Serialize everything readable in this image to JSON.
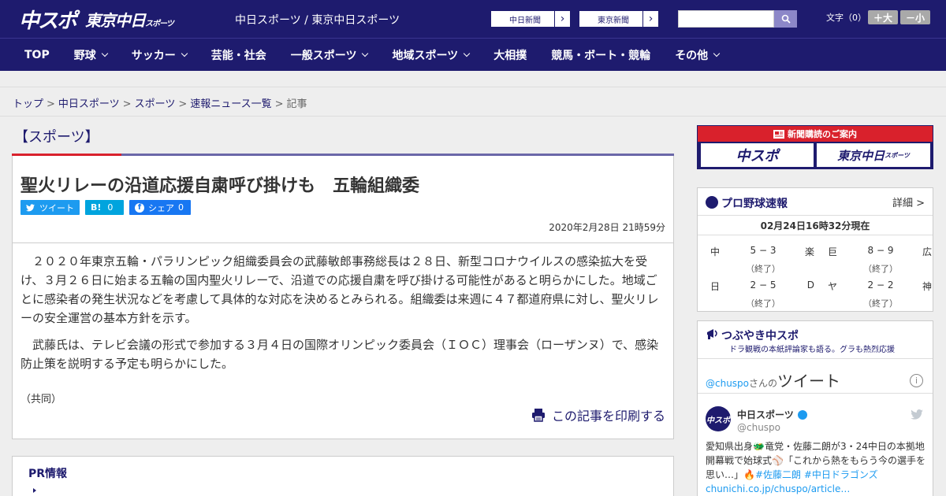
{
  "header": {
    "logo_main": "中スポ",
    "logo_sub": "東京中日",
    "logo_sub_small": "スポーツ",
    "site_link_1": "中日スポーツ",
    "site_link_sep": " / ",
    "site_link_2": "東京中日スポーツ",
    "btn_chunichi": "中日新聞",
    "btn_tokyo": "東京新聞",
    "search_placeholder": "",
    "font_size_label": "文字（0）",
    "font_plus": "＋大",
    "font_minus": "－小"
  },
  "nav": {
    "items": [
      {
        "label": "TOP",
        "dropdown": false
      },
      {
        "label": "野球",
        "dropdown": true
      },
      {
        "label": "サッカー",
        "dropdown": true
      },
      {
        "label": "芸能・社会",
        "dropdown": false
      },
      {
        "label": "一般スポーツ",
        "dropdown": true
      },
      {
        "label": "地域スポーツ",
        "dropdown": true
      },
      {
        "label": "大相撲",
        "dropdown": false
      },
      {
        "label": "競馬・ボート・競輪",
        "dropdown": false
      },
      {
        "label": "その他",
        "dropdown": true
      }
    ]
  },
  "breadcrumb": {
    "items": [
      "トップ",
      "中日スポーツ",
      "スポーツ",
      "速報ニュース一覧"
    ],
    "sep": ">",
    "current": "記事"
  },
  "article": {
    "section": "【スポーツ】",
    "headline": "聖火リレーの沿道応援自粛呼び掛けも　五輪組織委",
    "share_tweet": "ツイート",
    "share_hatena": "B!",
    "share_hatena_count": "0",
    "share_fb": "シェア",
    "share_fb_count": "0",
    "date": "2020年2月28日 21時59分",
    "paragraphs": [
      "２０２０年東京五輪・パラリンピック組織委員会の武藤敏郎事務総長は２８日、新型コロナウイルスの感染拡大を受け、３月２６日に始まる五輪の国内聖火リレーで、沿道での応援自粛を呼び掛ける可能性があると明らかにした。地域ごとに感染者の発生状況などを考慮して具体的な対応を決めるとみられる。組織委は来週に４７都道府県に対し、聖火リレーの安全運営の基本方針を示す。",
      "武藤氏は、テレビ会議の形式で参加する３月４日の国際オリンピック委員会（ＩＯＣ）理事会（ローザンヌ）で、感染防止策を説明する予定も明らかにした。"
    ],
    "credit": "（共同）",
    "print_label": "この記事を印刷する"
  },
  "pr": {
    "title": "PR情報"
  },
  "sidebar": {
    "subscribe_label": "新聞購読のご案内",
    "subscribe_tile_1": "中スポ",
    "subscribe_tile_2": "東京中日",
    "subscribe_tile_2_small": "スポーツ",
    "baseball": {
      "title": "プロ野球速報",
      "more": "詳細 >",
      "as_of": "02月24日16時32分現在",
      "games": [
        {
          "home": "中",
          "score": "5 − 3",
          "status": "（終了）",
          "away": "楽"
        },
        {
          "home": "巨",
          "score": "8 − 9",
          "status": "（終了）",
          "away": "広"
        },
        {
          "home": "日",
          "score": "2 − 5",
          "status": "（終了）",
          "away": "D"
        },
        {
          "home": "ヤ",
          "score": "2 − 2",
          "status": "（終了）",
          "away": "神"
        }
      ]
    },
    "tweets": {
      "title": "つぶやき中スポ",
      "subtitle": "ドラ観戦の本紙評論家も語る。グラも熱烈応援",
      "handle_link": "@chuspo",
      "handle_suffix": "さんの",
      "tweet_word": "ツイート",
      "avatar_text": "中スポ",
      "name": "中日スポーツ",
      "handle": "@chuspo",
      "text_1": "愛知県出身🐲竜党・佐藤二朗が3・24中日の本拠地開幕戦で始球式⚾「これから熱をもらう今の選手を思い…」🔥",
      "tag_1": "#佐藤二朗",
      "tag_2": "#中日ドラゴンズ",
      "link": "chunichi.co.jp/chuspo/article…"
    }
  },
  "colors": {
    "brand_navy": "#1e1b6e",
    "accent_red": "#d9212c",
    "twitter_blue": "#1d9bf0",
    "hatena_blue": "#00a4de",
    "facebook_blue": "#1877f2"
  }
}
